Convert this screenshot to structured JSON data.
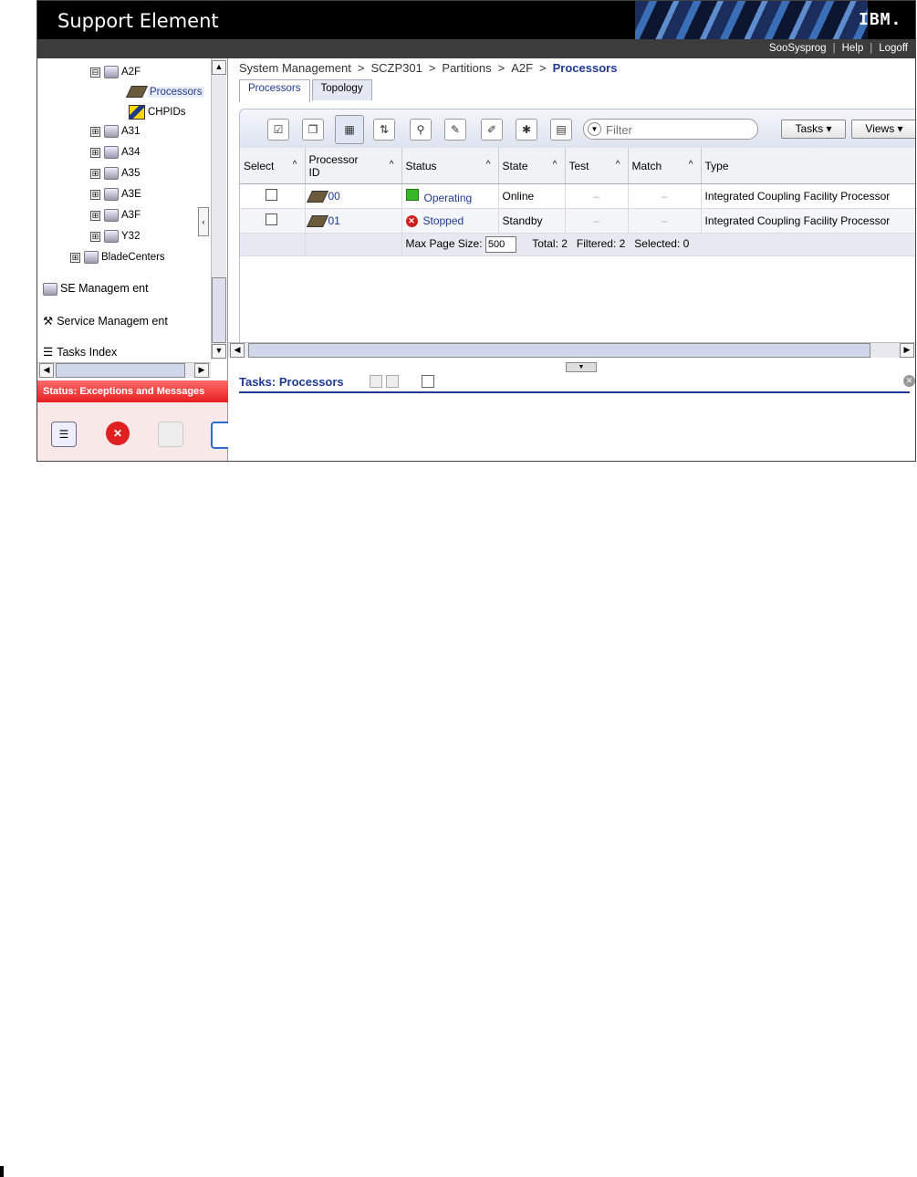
{
  "app": {
    "title": "Support Element",
    "logo": "IBM."
  },
  "userbar": {
    "user": "SooSysprog",
    "help": "Help",
    "logoff": "Logoff"
  },
  "tree": {
    "items": [
      {
        "label": "A2F",
        "expander": "⊟"
      },
      {
        "label": "Processors"
      },
      {
        "label": "CHPIDs"
      },
      {
        "label": "A31",
        "expander": "⊞"
      },
      {
        "label": "A34",
        "expander": "⊞"
      },
      {
        "label": "A35",
        "expander": "⊞"
      },
      {
        "label": "A3E",
        "expander": "⊞"
      },
      {
        "label": "A3F",
        "expander": "⊞"
      },
      {
        "label": "Y32",
        "expander": "⊞"
      },
      {
        "label": "BladeCenters",
        "expander": "⊞"
      }
    ],
    "se_management": "SE Managem ent",
    "service_management": "Service Managem ent",
    "tasks_index": "Tasks Index"
  },
  "status_bar": "Status: Exceptions and Messages",
  "breadcrumb": [
    "System Management",
    "SCZP301",
    "Partitions",
    "A2F",
    "Processors"
  ],
  "tabs": [
    "Processors",
    "Topology"
  ],
  "toolbar": {
    "filter_placeholder": "Filter",
    "tasks": "Tasks ▾",
    "views": "Views ▾"
  },
  "table": {
    "headers": [
      "Select",
      "Processor ID",
      "Status",
      "State",
      "Test",
      "Match",
      "Type"
    ],
    "rows": [
      {
        "id": "00",
        "status": "Operating",
        "state": "Online",
        "test": "–",
        "match": "–",
        "type": "Integrated Coupling Facility Processor"
      },
      {
        "id": "01",
        "status": "Stopped",
        "state": "Standby",
        "test": "–",
        "match": "–",
        "type": "Integrated Coupling Facility Processor"
      }
    ],
    "footer": {
      "max_page_label": "Max Page Size:",
      "max_page_value": "500",
      "summary": "Total: 2   Filtered: 2   Selected: 0"
    }
  },
  "tasks_panel": {
    "title": "Tasks: Processors"
  },
  "colors": {
    "accent": "#1f3a93",
    "status_red": "#e81e1e",
    "operating_green": "#3bb82a"
  }
}
